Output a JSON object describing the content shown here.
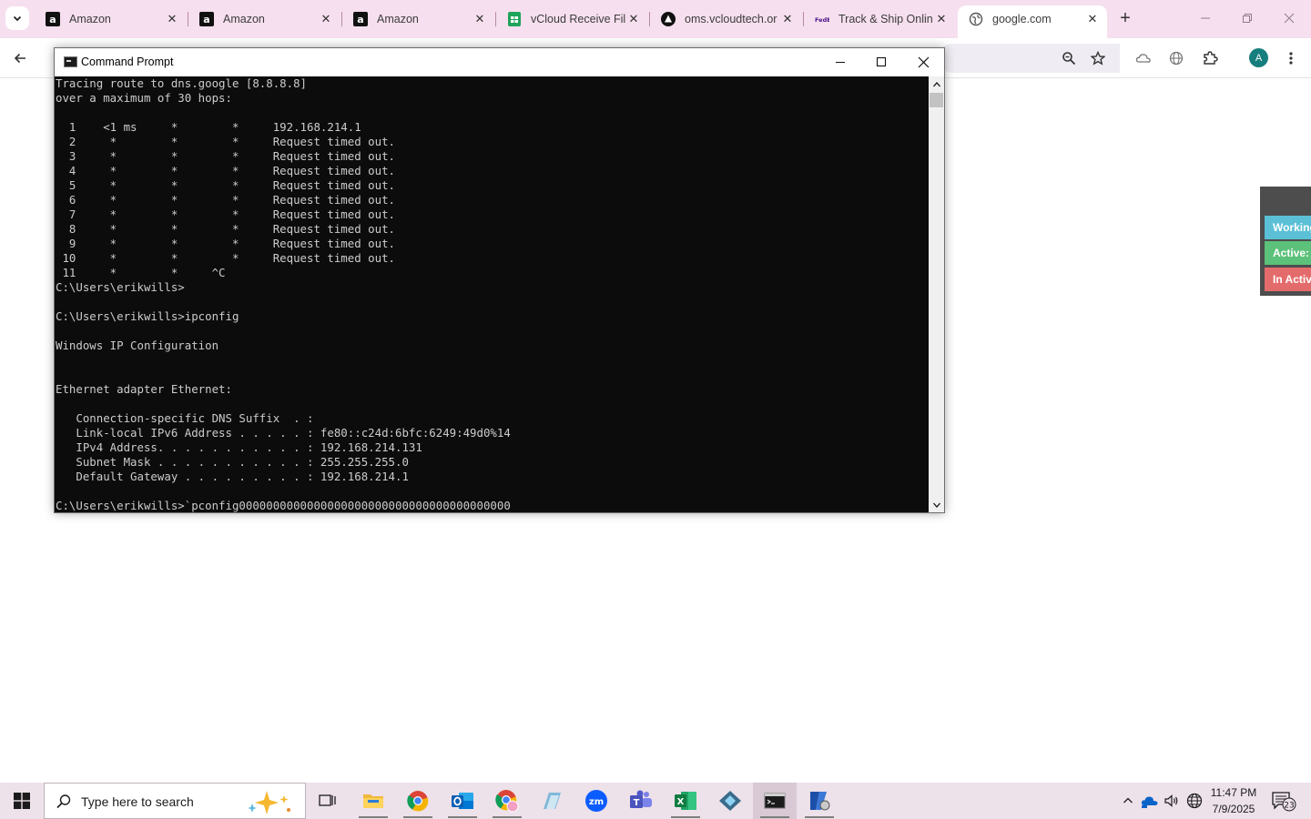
{
  "browser": {
    "tabs": [
      {
        "title": "Amazon",
        "icon": "amazon-icon"
      },
      {
        "title": "Amazon",
        "icon": "amazon-icon"
      },
      {
        "title": "Amazon",
        "icon": "amazon-icon"
      },
      {
        "title": "vCloud Receive Fil",
        "icon": "sheets-icon"
      },
      {
        "title": "oms.vcloudtech.or",
        "icon": "triangle-logo-icon"
      },
      {
        "title": "Track & Ship Onlin",
        "icon": "fedex-icon"
      },
      {
        "title": "google.com",
        "icon": "globe-icon",
        "active": true
      }
    ],
    "avatar_letter": "A",
    "fedex_logo": "FedEx"
  },
  "status_widget": {
    "items": [
      {
        "label": "Working",
        "color": "#5bc0d6"
      },
      {
        "label": "Active:",
        "color": "#5cc17a"
      },
      {
        "label": "In Active",
        "color": "#e46b6b"
      }
    ]
  },
  "cmd": {
    "title": "Command Prompt",
    "lines": [
      "Tracing route to dns.google [8.8.8.8]",
      "over a maximum of 30 hops:",
      "",
      "  1    <1 ms     *        *     192.168.214.1",
      "  2     *        *        *     Request timed out.",
      "  3     *        *        *     Request timed out.",
      "  4     *        *        *     Request timed out.",
      "  5     *        *        *     Request timed out.",
      "  6     *        *        *     Request timed out.",
      "  7     *        *        *     Request timed out.",
      "  8     *        *        *     Request timed out.",
      "  9     *        *        *     Request timed out.",
      " 10     *        *        *     Request timed out.",
      " 11     *        *     ^C",
      "C:\\Users\\erikwills>",
      "",
      "C:\\Users\\erikwills>ipconfig",
      "",
      "Windows IP Configuration",
      "",
      "",
      "Ethernet adapter Ethernet:",
      "",
      "   Connection-specific DNS Suffix  . :",
      "   Link-local IPv6 Address . . . . . : fe80::c24d:6bfc:6249:49d0%14",
      "   IPv4 Address. . . . . . . . . . . : 192.168.214.131",
      "   Subnet Mask . . . . . . . . . . . : 255.255.255.0",
      "   Default Gateway . . . . . . . . . : 192.168.214.1",
      "",
      "C:\\Users\\erikwills>`pconfig0000000000000000000000000000000000000000"
    ]
  },
  "taskbar": {
    "search_placeholder": "Type here to search",
    "time": "11:47 PM",
    "date": "7/9/2025",
    "notification_count": "23"
  }
}
